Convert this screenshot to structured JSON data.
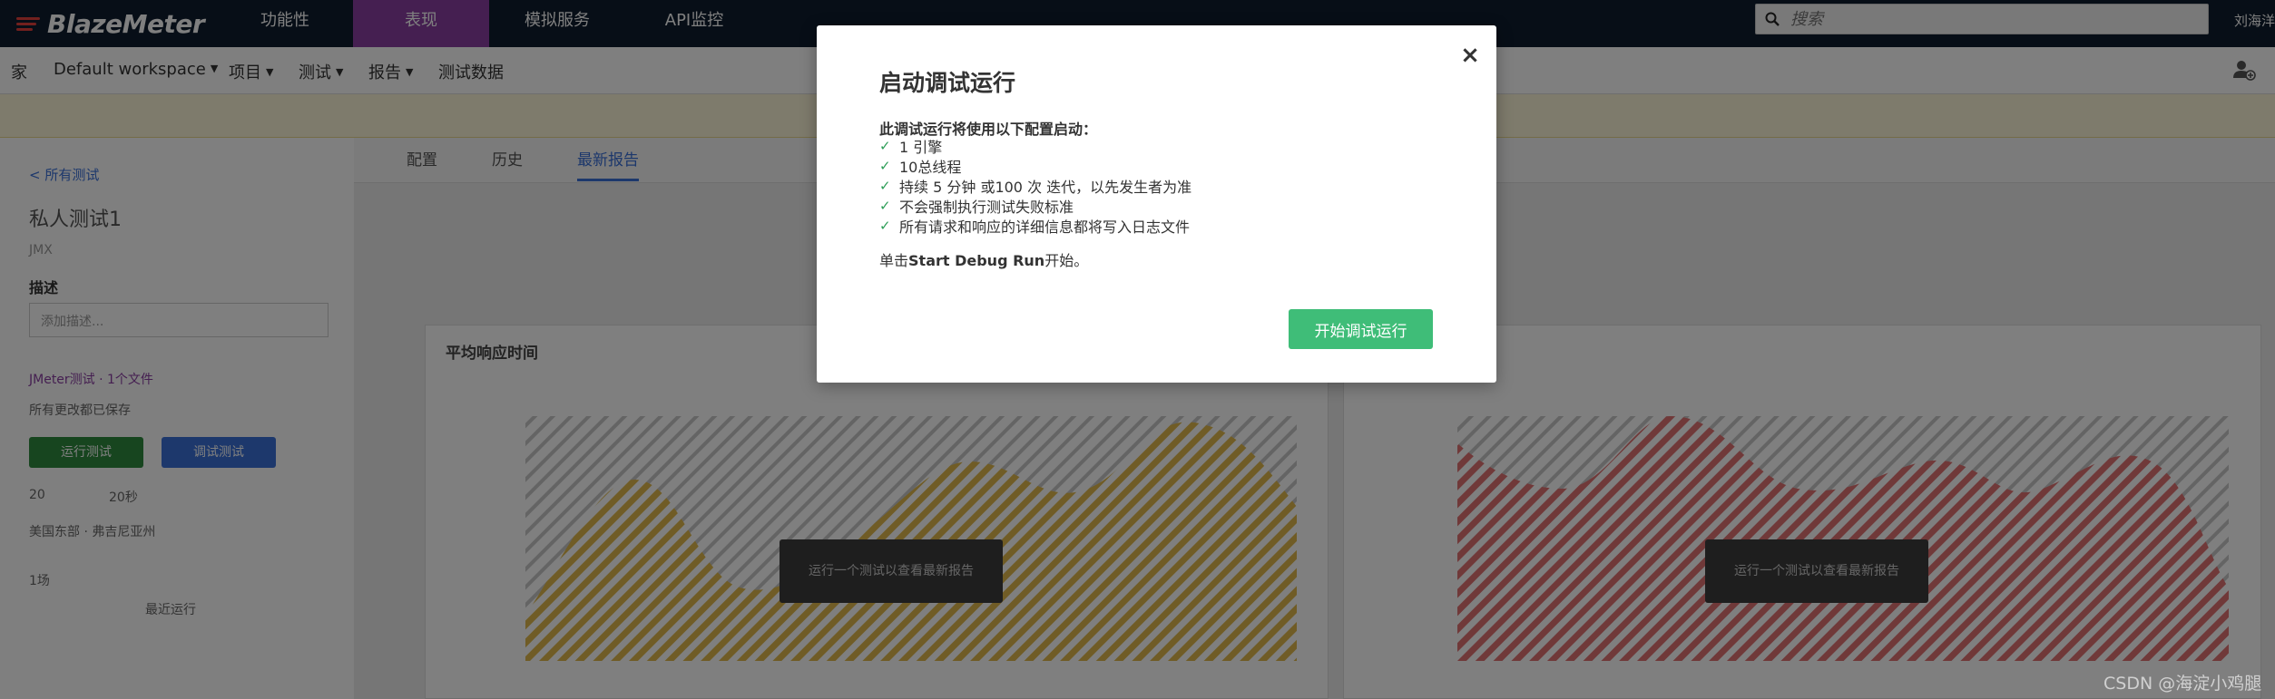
{
  "brand": {
    "name": "BlazeMeter",
    "accent": "#e4403d"
  },
  "topnav": {
    "items": [
      {
        "label": "功能性",
        "active": false
      },
      {
        "label": "表现",
        "active": true
      },
      {
        "label": "模拟服务",
        "active": false
      },
      {
        "label": "API监控",
        "active": false
      }
    ],
    "search_placeholder": "搜索",
    "user": "刘海洋"
  },
  "subnav": {
    "home": "家",
    "workspace": "Default workspace",
    "projects": "项目",
    "tests": "测试",
    "reports": "报告",
    "test_data": "测试数据"
  },
  "left_panel": {
    "back": "< 所有测试",
    "title": "私人测试1",
    "subtitle": "JMX",
    "label": "描述",
    "select_placeholder": "添加描述...",
    "line1": "JMeter测试 · 1个文件",
    "line2": "所有更改都已保存",
    "run_label": "运行测试",
    "debug_label": "调试测试",
    "stat_users": "20",
    "stat_locations": "20秒",
    "line3": "美国东部 · 弗吉尼亚州",
    "line4": "1场",
    "line5": "最近运行"
  },
  "tabs": [
    {
      "label": "配置",
      "active": false
    },
    {
      "label": "历史",
      "active": false
    },
    {
      "label": "最新报告",
      "active": true
    }
  ],
  "charts": [
    {
      "title": "平均响应时间",
      "overlay": "运行一个测试以查看最新报告"
    },
    {
      "title": "",
      "overlay": "运行一个测试以查看最新报告"
    }
  ],
  "modal": {
    "title": "启动调试运行",
    "close_symbol": "×",
    "intro": "此调试运行将使用以下配置启动：",
    "items": [
      "1 引擎",
      "10总线程",
      "持续 5 分钟 或100 次 迭代，以先发生者为准",
      "不会强制执行测试失败标准",
      "所有请求和响应的详细信息都将写入日志文件"
    ],
    "note_prefix": "单击",
    "note_bold": "Start Debug Run",
    "note_suffix": "开始。",
    "start_button": "开始调试运行"
  },
  "watermark": "CSDN @海淀小鸡腿"
}
